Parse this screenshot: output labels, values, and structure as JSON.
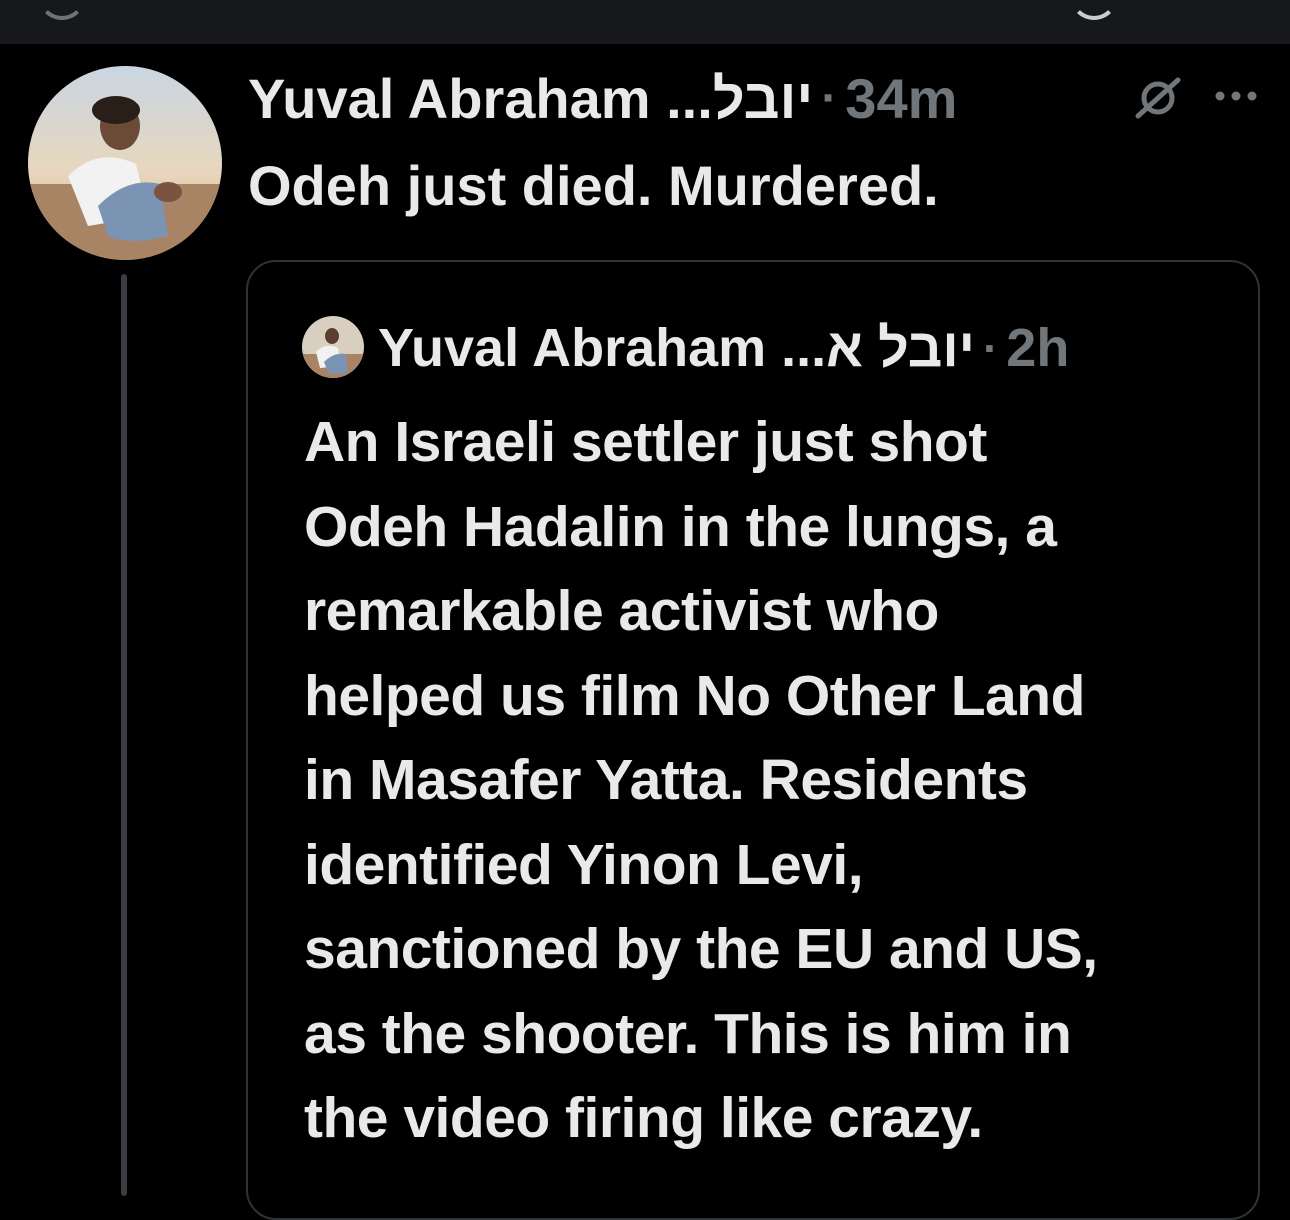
{
  "post": {
    "author_name": "Yuval Abraham ...יובל",
    "dot": "·",
    "time": "34m",
    "text": "Odeh just died. Murdered."
  },
  "quoted_post": {
    "author_name": "Yuval Abraham ...יובל א",
    "dot": "·",
    "time": "2h",
    "lines": [
      "An Israeli settler just shot",
      "Odeh Hadalin in the lungs, a",
      "remarkable activist who",
      "helped us film No Other Land",
      "in Masafer Yatta. Residents",
      "identified Yinon Levi,",
      "sanctioned by the EU and US,",
      "as the shooter. This is him in",
      "the video firing like crazy."
    ]
  },
  "icons": {
    "avatar": "profile-photo",
    "mute": "mute-icon",
    "more": "more-icon"
  },
  "colors": {
    "background": "#000000",
    "text": "#e7e9ea",
    "secondary_text": "#71767b",
    "border": "#2f3336",
    "thread_line": "#3a3d41"
  }
}
